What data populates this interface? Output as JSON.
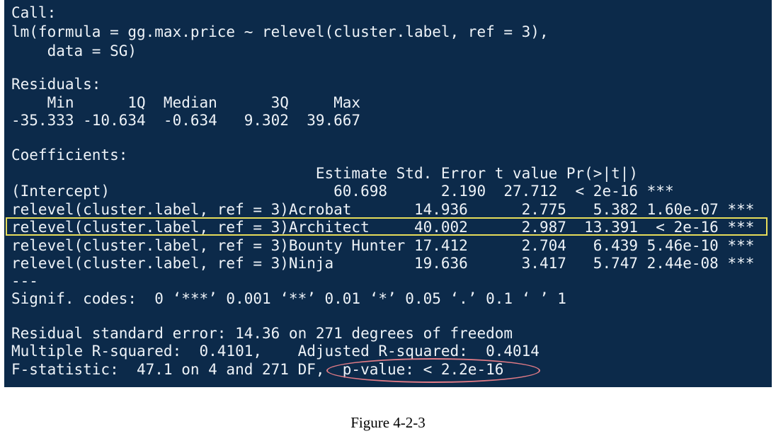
{
  "console": {
    "call_header": "Call:",
    "call_line1": "lm(formula = gg.max.price ~ relevel(cluster.label, ref = 3),",
    "call_line2": "    data = SG)",
    "residuals_header": "Residuals:",
    "residuals_labels": "    Min      1Q  Median      3Q     Max",
    "residuals_values": "-35.333 -10.634  -0.634   9.302  39.667",
    "coefficients_header": "Coefficients:",
    "coef_columns": "                                  Estimate Std. Error t value Pr(>|t|)    ",
    "coef_rows": [
      "(Intercept)                         60.698      2.190  27.712  < 2e-16 ***",
      "relevel(cluster.label, ref = 3)Acrobat       14.936      2.775   5.382 1.60e-07 ***",
      "relevel(cluster.label, ref = 3)Architect     40.002      2.987  13.391  < 2e-16 ***",
      "relevel(cluster.label, ref = 3)Bounty Hunter 17.412      2.704   6.439 5.46e-10 ***",
      "relevel(cluster.label, ref = 3)Ninja         19.636      3.417   5.747 2.44e-08 ***"
    ],
    "separator": "---",
    "signif_codes": "Signif. codes:  0 ‘***’ 0.001 ‘**’ 0.01 ‘*’ 0.05 ‘.’ 0.1 ‘ ’ 1",
    "rse_line": "Residual standard error: 14.36 on 271 degrees of freedom",
    "r2_line": "Multiple R-squared:  0.4101,    Adjusted R-squared:  0.4014 ",
    "f_line": "F-statistic:  47.1 on 4 and 271 DF,  p-value: < 2.2e-16"
  },
  "caption": "Figure 4-2-3",
  "colors": {
    "console_background": "#0c2a4a",
    "console_text": "#eef3f8",
    "highlight_box": "#e6dc5a",
    "pvalue_ellipse": "#e27b86"
  }
}
